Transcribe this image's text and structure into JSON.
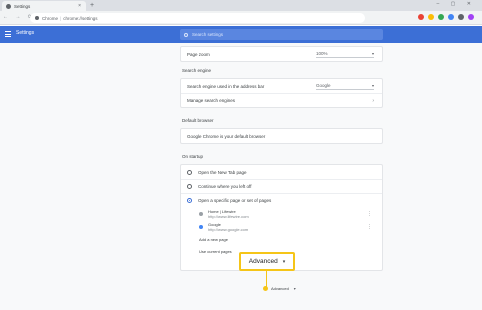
{
  "tab": {
    "title": "Settings",
    "close": "×",
    "new_tab": "+"
  },
  "window_controls": "– ▢ ✕",
  "nav_buttons": "← → ⟳",
  "address": {
    "site": "Chrome",
    "sep": "|",
    "path": "chrome://settings"
  },
  "extension_colors": [
    "#e94235",
    "#fbbc04",
    "#34a853",
    "#4285f4",
    "#5f6368",
    "#a142f4"
  ],
  "header": {
    "title": "Settings",
    "search_placeholder": "Search settings"
  },
  "appearance": {
    "page_zoom_label": "Page zoom",
    "page_zoom_value": "100%"
  },
  "search_engine": {
    "section_title": "Search engine",
    "used_in_address_bar_label": "Search engine used in the address bar",
    "engine_value": "Google",
    "manage_label": "Manage search engines"
  },
  "default_browser": {
    "section_title": "Default browser",
    "status_text": "Google Chrome is your default browser"
  },
  "on_startup": {
    "section_title": "On startup",
    "options": [
      "Open the New Tab page",
      "Continue where you left off",
      "Open a specific page or set of pages"
    ],
    "selected_index": 2,
    "pages": [
      {
        "name": "Home | Lifewire",
        "url": "http://www.lifewire.com"
      },
      {
        "name": "Google",
        "url": "http://www.google.com"
      }
    ],
    "add_page_label": "Add a new page",
    "use_current_label": "Use current pages"
  },
  "callout": {
    "label": "Advanced",
    "caret": "▾"
  },
  "advanced_bottom": {
    "label": "Advanced",
    "caret": "▾"
  },
  "chevron": "›",
  "kebab": "⋮",
  "select_caret": "▾"
}
